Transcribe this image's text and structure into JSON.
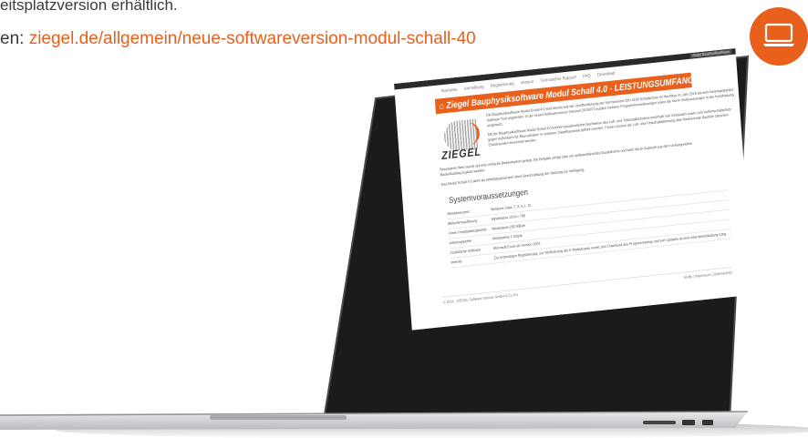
{
  "header": {
    "line1": "eitsplatzversion erhältlich.",
    "link_prefix": "en: ",
    "link_text": "ziegel.de/allgemein/neue-softwareversion-modul-schall-40"
  },
  "badge": {
    "icon": "laptop-icon",
    "color": "#e8601c"
  },
  "screen": {
    "topbar_label": "Ziegel Bauphysiksoftware",
    "nav": [
      "Startseite",
      "Anmeldung",
      "Registrierung",
      "Version",
      "Technischer Support",
      "FAQ",
      "Download"
    ],
    "banner_title": "Ziegel Bauphysiksoftware Modul Schall 4.0 - LEISTUNGSUMFANG",
    "logo_word": "ZIEGEL",
    "intro_p1": "Die Bauphysiksoftware Modul Schall 4.0 wird bereits seit der Veröffentlichung der Normenreihe DIN 4109 Schallschutz im Hochbau im Jahr 2016 als sehr leistungsstarkes Software-Tool angeboten. In der neuen Softwareversion (Version 2019/07) wurden mehrere Programmerweiterungen sowie die Norm Verbesserungen in der Handhabung umgesetzt.",
    "intro_p2": "Mit der Bauphysiksoftware Modul Schall 4.0 können bauakustische Nachweise des Luft- und Trittschallschutzes innerhalb von Gebäuden sowie zum Außenschallschutz gegen Außenlärm für Bauvorhaben in massiver Ziegelbauweise geführt werden. Ferner können die Luft- und Trittschalldämmung über flankierende Bauteile zwischen Einzelräumen berechnet werden.",
    "text_p1": "Besonderer Wert wurde auf eine einfache Bedienbarkeit gelegt. Die Eingabe erfolgt über ein selbsterklärendes Bauteilmenü und kann durch Auswahl aus dem umfangreichen Bauteilkatalog ergänzt werden.",
    "text_p2": "Das Modul Schall 4.0 steht als Arbeitsplatzversion ohne Beschränkung der Nutzung zur Verfügung.",
    "requirements_heading": "Systemvoraussetzungen",
    "requirements": [
      {
        "label": "Betriebssystem",
        "value": "Windows Vista, 7, 8, 8.1, 10"
      },
      {
        "label": "Bildschirmauflösung",
        "value": "Mindestens 1024 x 768"
      },
      {
        "label": "Freier Festplattenspeicher",
        "value": "Mindestens 200 MByte"
      },
      {
        "label": "Arbeitsspeicher",
        "value": "Mindestens 1 GByte"
      },
      {
        "label": "Zusätzliche Software",
        "value": "Microsoft Excel ab Version 2003"
      },
      {
        "label": "Internet",
        "value": "Zur erstmaligen Registrierung, zur Verifizierung der E-Mailadresse sowie zum Download des Programmsetup und von Updates ist eine Internetverbindung nötig."
      }
    ],
    "footer_left": "© 2019 · ZIEGEL Software Service GmbH & Co KG",
    "footer_right": "AGBs | Impressum | Datenschutz"
  }
}
